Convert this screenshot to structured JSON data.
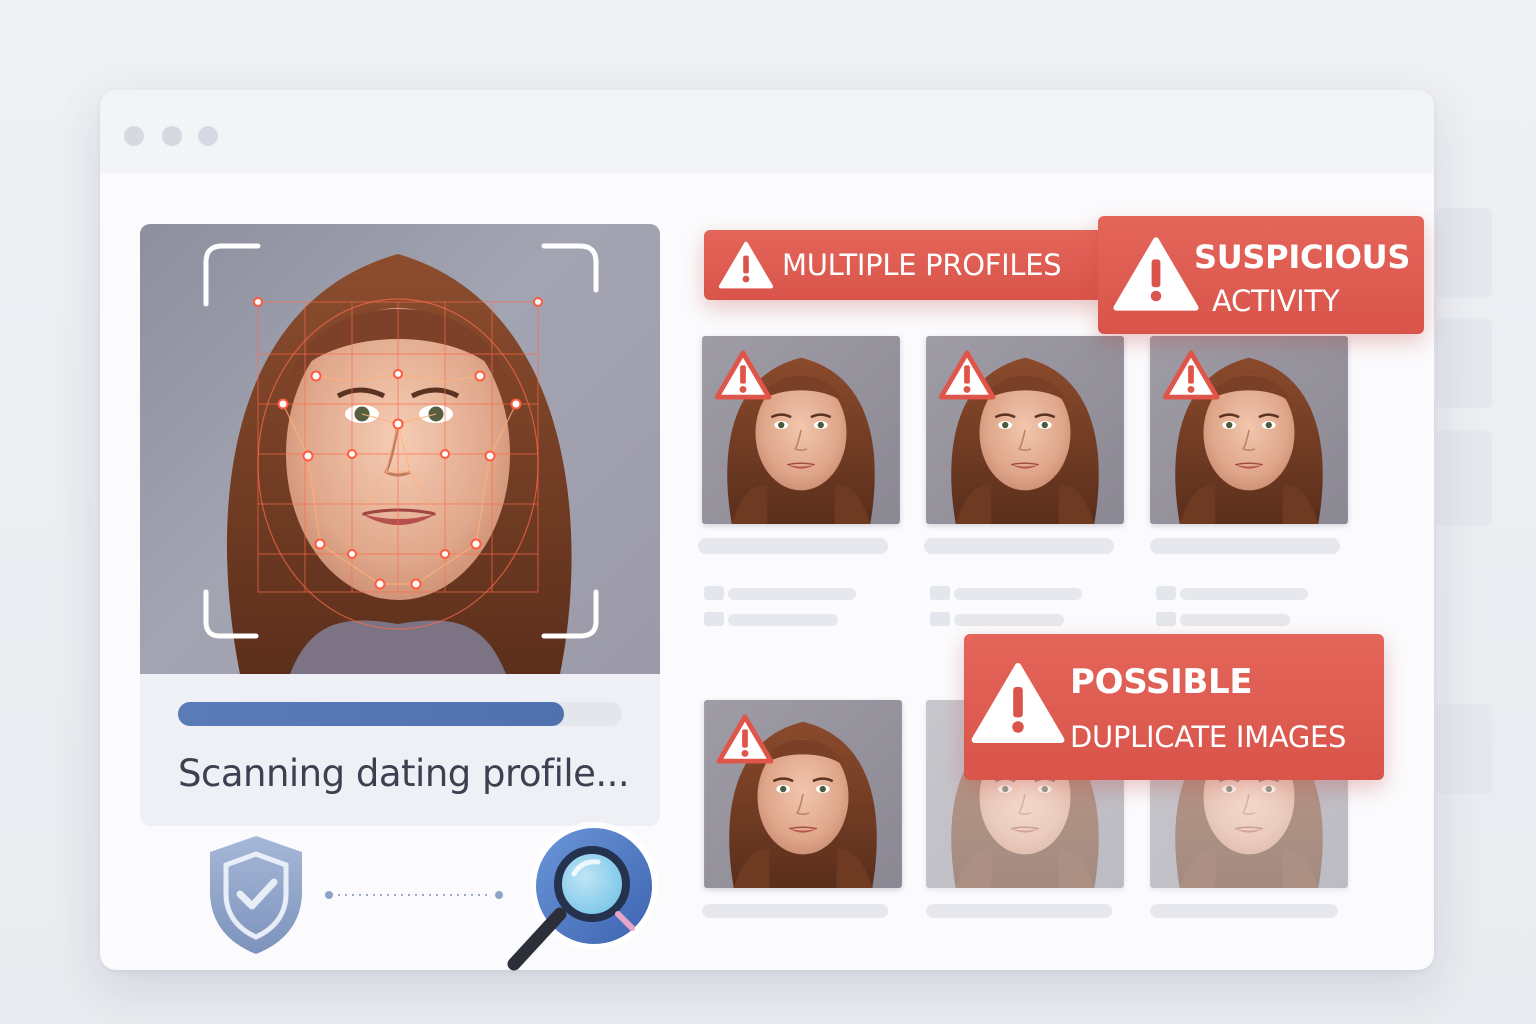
{
  "window": {
    "title_dots": [
      "dot-1",
      "dot-2",
      "dot-3"
    ]
  },
  "scanner": {
    "status_text": "Scanning dating profile...",
    "progress": 0.87
  },
  "alerts": {
    "multiple_profiles": "MULTIPLE PROFILES",
    "suspicious_line1": "SUSPICIOUS",
    "suspicious_line2": "ACTIVITY",
    "duplicate_line1": "POSSIBLE",
    "duplicate_line2": "DUPLICATE IMAGES"
  },
  "icons": {
    "warning": "warning-triangle-icon",
    "shield": "shield-check-icon",
    "search": "magnifier-icon"
  },
  "colors": {
    "alert": "#dc5a4e",
    "progress": "#5576b2",
    "shield": "#8ea3c8",
    "magnifier": "#4f7cc7"
  }
}
